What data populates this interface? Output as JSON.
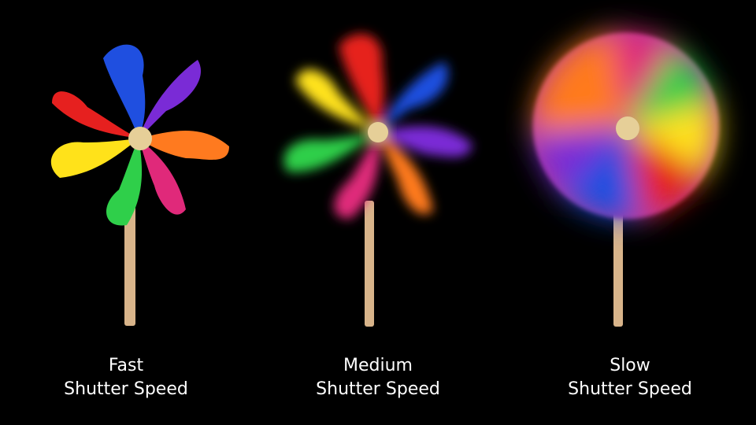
{
  "panels": [
    {
      "line1": "Fast",
      "line2": "Shutter Speed",
      "blur": "none"
    },
    {
      "line1": "Medium",
      "line2": "Shutter Speed",
      "blur": "medium"
    },
    {
      "line1": "Slow",
      "line2": "Shutter Speed",
      "blur": "heavy"
    }
  ],
  "colors": {
    "background": "#000000",
    "caption": "#ffffff",
    "stick": "#d8b48a",
    "hub": "#e6cf98",
    "blades": [
      "#1f4fe0",
      "#7a2bd6",
      "#ff7a1f",
      "#e0297a",
      "#2fcf4a",
      "#ffe21a",
      "#e6201f"
    ]
  }
}
